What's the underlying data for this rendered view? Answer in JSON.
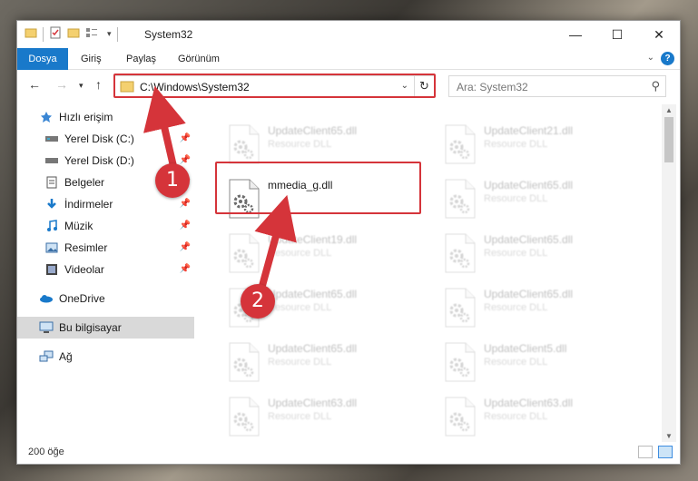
{
  "window": {
    "title": "System32",
    "controls": {
      "minimize": "—",
      "maximize": "☐",
      "close": "✕"
    }
  },
  "ribbon": {
    "tabs": [
      "Dosya",
      "Giriş",
      "Paylaş",
      "Görünüm"
    ],
    "help": "?"
  },
  "navbar": {
    "address": "C:\\Windows\\System32",
    "search_placeholder": "Ara: System32"
  },
  "sidebar": {
    "items": [
      {
        "label": "Hızlı erişim",
        "icon": "star-icon",
        "pinned": false
      },
      {
        "label": "Yerel Disk (C:)",
        "icon": "drive-icon",
        "pinned": true
      },
      {
        "label": "Yerel Disk (D:)",
        "icon": "drive-icon",
        "pinned": true
      },
      {
        "label": "Belgeler",
        "icon": "documents-icon",
        "pinned": true
      },
      {
        "label": "İndirmeler",
        "icon": "download-icon",
        "pinned": true
      },
      {
        "label": "Müzik",
        "icon": "music-icon",
        "pinned": true
      },
      {
        "label": "Resimler",
        "icon": "pictures-icon",
        "pinned": true
      },
      {
        "label": "Videolar",
        "icon": "videos-icon",
        "pinned": true
      },
      {
        "label": "OneDrive",
        "icon": "cloud-icon",
        "pinned": false
      },
      {
        "label": "Bu bilgisayar",
        "icon": "computer-icon",
        "pinned": false,
        "selected": true
      },
      {
        "label": "Ağ",
        "icon": "network-icon",
        "pinned": false
      }
    ]
  },
  "files": [
    {
      "name": "UpdateClient65.dll",
      "type": "Resource DLL",
      "highlighted": false
    },
    {
      "name": "UpdateClient21.dll",
      "type": "Resource DLL",
      "highlighted": false
    },
    {
      "name": "mmedia_g.dll",
      "type": "",
      "highlighted": true
    },
    {
      "name": "UpdateClient65.dll",
      "type": "Resource DLL",
      "highlighted": false
    },
    {
      "name": "UpdateClient19.dll",
      "type": "Resource DLL",
      "highlighted": false
    },
    {
      "name": "UpdateClient65.dll",
      "type": "Resource DLL",
      "highlighted": false
    },
    {
      "name": "UpdateClient65.dll",
      "type": "Resource DLL",
      "highlighted": false
    },
    {
      "name": "UpdateClient65.dll",
      "type": "Resource DLL",
      "highlighted": false
    },
    {
      "name": "UpdateClient65.dll",
      "type": "Resource DLL",
      "highlighted": false
    },
    {
      "name": "UpdateClient5.dll",
      "type": "Resource DLL",
      "highlighted": false
    },
    {
      "name": "UpdateClient63.dll",
      "type": "Resource DLL",
      "highlighted": false
    },
    {
      "name": "UpdateClient63.dll",
      "type": "Resource DLL",
      "highlighted": false
    }
  ],
  "status": {
    "count": "200 öğe"
  },
  "callouts": [
    "1",
    "2"
  ],
  "colors": {
    "accent": "#1979ca",
    "callout": "#d5343a"
  }
}
